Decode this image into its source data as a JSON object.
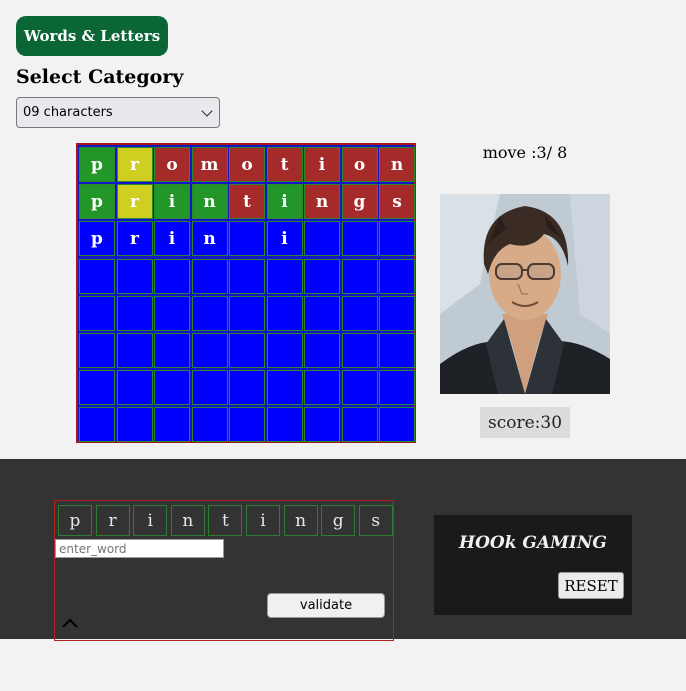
{
  "header": {
    "title_button": "Words & Letters"
  },
  "category": {
    "heading": "Select Category",
    "selected": "09 characters"
  },
  "board": {
    "rows": [
      {
        "letters": [
          "p",
          "r",
          "o",
          "m",
          "o",
          "t",
          "i",
          "o",
          "n"
        ],
        "states": [
          "green",
          "yellow",
          "red",
          "red",
          "red",
          "red",
          "red",
          "red",
          "red"
        ]
      },
      {
        "letters": [
          "p",
          "r",
          "i",
          "n",
          "t",
          "i",
          "n",
          "g",
          "s"
        ],
        "states": [
          "green",
          "yellow",
          "green",
          "green",
          "red",
          "green",
          "red",
          "red",
          "red"
        ]
      },
      {
        "letters": [
          "p",
          "r",
          "i",
          "n",
          "",
          "i",
          "",
          "",
          ""
        ],
        "states": [
          "blue",
          "blue",
          "blue",
          "blue",
          "blue",
          "blue",
          "blue",
          "blue",
          "blue"
        ]
      },
      {
        "letters": [
          "",
          "",
          "",
          "",
          "",
          "",
          "",
          "",
          ""
        ],
        "states": [
          "blue",
          "blue",
          "blue",
          "blue",
          "blue",
          "blue",
          "blue",
          "blue",
          "blue"
        ]
      },
      {
        "letters": [
          "",
          "",
          "",
          "",
          "",
          "",
          "",
          "",
          ""
        ],
        "states": [
          "blue",
          "blue",
          "blue",
          "blue",
          "blue",
          "blue",
          "blue",
          "blue",
          "blue"
        ]
      },
      {
        "letters": [
          "",
          "",
          "",
          "",
          "",
          "",
          "",
          "",
          ""
        ],
        "states": [
          "blue",
          "blue",
          "blue",
          "blue",
          "blue",
          "blue",
          "blue",
          "blue",
          "blue"
        ]
      },
      {
        "letters": [
          "",
          "",
          "",
          "",
          "",
          "",
          "",
          "",
          ""
        ],
        "states": [
          "blue",
          "blue",
          "blue",
          "blue",
          "blue",
          "blue",
          "blue",
          "blue",
          "blue"
        ]
      },
      {
        "letters": [
          "",
          "",
          "",
          "",
          "",
          "",
          "",
          "",
          ""
        ],
        "states": [
          "blue",
          "blue",
          "blue",
          "blue",
          "blue",
          "blue",
          "blue",
          "blue",
          "blue"
        ]
      }
    ]
  },
  "status": {
    "move_text": "move :3/ 8",
    "score_text": "score:30"
  },
  "entry": {
    "tiles": [
      "p",
      "r",
      "i",
      "n",
      "t",
      "i",
      "n",
      "g",
      "s"
    ],
    "input_placeholder": "enter_word",
    "input_value": "",
    "validate_label": "validate"
  },
  "brand": {
    "name": "HOOk GAMING",
    "reset_label": "RESET"
  },
  "colors": {
    "green": "#23962a",
    "yellow": "#cfcf22",
    "red": "#a52a2a",
    "blue": "#0000ff",
    "title_bg": "#0b6635",
    "band_bg": "#333333"
  },
  "icons": {
    "select_arrow": "chevron-down-icon",
    "collapse": "chevron-up-icon",
    "avatar": "character-portrait"
  }
}
